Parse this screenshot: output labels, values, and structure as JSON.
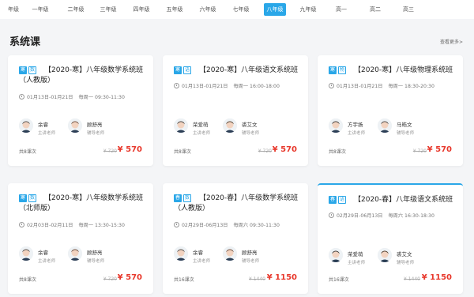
{
  "grades": [
    "年级",
    "一年级",
    "二年级",
    "三年级",
    "四年级",
    "五年级",
    "六年级",
    "七年级",
    "八年级",
    "九年级",
    "高一",
    "高二",
    "高三"
  ],
  "active_grade": "八年级",
  "section": {
    "title": "系统课",
    "more_label": "查看更多>"
  },
  "courses": [
    {
      "tags": [
        "寒",
        "数"
      ],
      "title": "【2020-寒】八年级数学系统班（人教版）",
      "date": "01月13日-01月21日",
      "schedule": "每周一 09:30-11:30",
      "teachers": [
        {
          "name": "余睿",
          "role": "主讲老师"
        },
        {
          "name": "顾舒亮",
          "role": "辅导老师"
        }
      ],
      "lessons": "共8课次",
      "orig_price": "¥ 720",
      "price": "¥ 570"
    },
    {
      "tags": [
        "寒",
        "语"
      ],
      "title": "【2020-寒】八年级语文系统班",
      "date": "01月13日-01月21日",
      "schedule": "每周一 16:00-18:00",
      "teachers": [
        {
          "name": "荣爱萌",
          "role": "主讲老师"
        },
        {
          "name": "裘艾文",
          "role": "辅导老师"
        }
      ],
      "lessons": "共8课次",
      "orig_price": "¥ 720",
      "price": "¥ 570"
    },
    {
      "tags": [
        "寒",
        "物"
      ],
      "title": "【2020-寒】八年级物理系统班",
      "date": "01月13日-01月21日",
      "schedule": "每周一 18:30-20:30",
      "teachers": [
        {
          "name": "方宇扬",
          "role": "主讲老师"
        },
        {
          "name": "马皓文",
          "role": "辅导老师"
        }
      ],
      "lessons": "共8课次",
      "orig_price": "¥ 720",
      "price": "¥ 570"
    },
    {
      "tags": [
        "寒",
        "数"
      ],
      "title": "【2020-寒】八年级数学系统班（北师版）",
      "date": "02月03日-02月11日",
      "schedule": "每周一 13:30-15:30",
      "teachers": [
        {
          "name": "余睿",
          "role": "主讲老师"
        },
        {
          "name": "顾舒亮",
          "role": "辅导老师"
        }
      ],
      "lessons": "共8课次",
      "orig_price": "¥ 720",
      "price": "¥ 570"
    },
    {
      "tags": [
        "春",
        "数"
      ],
      "title": "【2020-春】八年级数学系统班（人教版）",
      "date": "02月29日-06月13日",
      "schedule": "每周六 09:30-11:30",
      "teachers": [
        {
          "name": "余睿",
          "role": "主讲老师"
        },
        {
          "name": "顾舒亮",
          "role": "辅导老师"
        }
      ],
      "lessons": "共16课次",
      "orig_price": "¥ 1440",
      "price": "¥ 1150"
    },
    {
      "tags": [
        "春",
        "语"
      ],
      "title": "【2020-春】八年级语文系统班",
      "date": "02月29日-06月13日",
      "schedule": "每周六 16:30-18:30",
      "teachers": [
        {
          "name": "荣爱萌",
          "role": "主讲老师"
        },
        {
          "name": "裘艾文",
          "role": "辅导老师"
        }
      ],
      "lessons": "共16课次",
      "orig_price": "¥ 1440",
      "price": "¥ 1150"
    }
  ],
  "colors": {
    "accent": "#2aa7e8",
    "price": "#e8382c"
  }
}
